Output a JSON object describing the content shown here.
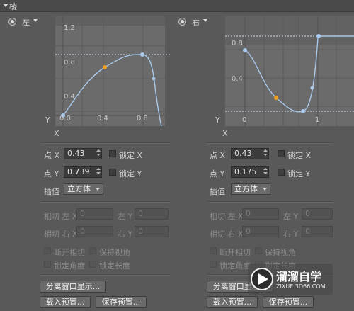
{
  "panel": {
    "title": "棱"
  },
  "left": {
    "side_label": "左",
    "x_axis_label": "X",
    "y_axis_label": "Y",
    "y_ticks": [
      "1.2",
      "0.8",
      "0.4"
    ],
    "x_ticks": [
      "0.0",
      "0.4",
      "0.8"
    ],
    "point_x_label": "点 X",
    "point_x_value": "0.43",
    "point_y_label": "点 Y",
    "point_y_value": "0.739",
    "lock_x_label": "锁定 X",
    "lock_y_label": "锁定 Y",
    "interp_label": "插值",
    "interp_value": "立方体",
    "tan_left_x_label": "相切 左 X",
    "tan_left_x_value": "0",
    "left_y_label": "左 Y",
    "left_y_value": "0",
    "tan_right_x_label": "相切 右 X",
    "tan_right_x_value": "0",
    "right_y_label": "右 Y",
    "right_y_value": "0",
    "break_tangents_label": "断开相切",
    "keep_view_label": "保持视角",
    "lock_angle_label": "锁定角度",
    "lock_length_label": "锁定长度",
    "detach_button": "分离窗口显示...",
    "load_preset_button": "载入预置...",
    "save_preset_button": "保存预置..."
  },
  "right": {
    "side_label": "右",
    "x_axis_label": "X",
    "y_axis_label": "Y",
    "y_ticks": [
      "0.8",
      "0.4"
    ],
    "x_ticks": [
      "0",
      "1"
    ],
    "point_x_label": "点 X",
    "point_x_value": "0.43",
    "point_y_label": "点 Y",
    "point_y_value": "0.175",
    "lock_x_label": "锁定 X",
    "lock_y_label": "锁定 Y",
    "interp_label": "插值",
    "interp_value": "立方体",
    "tan_left_x_label": "相切 左 X",
    "tan_left_x_value": "0",
    "left_y_label": "左 Y",
    "left_y_value": "0",
    "tan_right_x_label": "相切 右 X",
    "tan_right_x_value": "0",
    "right_y_label": "右 Y",
    "right_y_value": "0",
    "break_tangents_label": "断开相切",
    "keep_view_label": "保持视角",
    "lock_angle_label": "锁定角度",
    "lock_length_label": "锁定长度",
    "detach_button": "分离窗口显示...",
    "load_preset_button": "载入预置...",
    "save_preset_button": "保存预置..."
  },
  "watermark": {
    "title": "溜溜自学",
    "url": "ZIXUE.3D66.COM"
  },
  "colors": {
    "curve": "#a8c8ec",
    "selected_point": "#f0a020",
    "grid": "#5a5a5a",
    "graph_bg": "#6b6b6b"
  }
}
